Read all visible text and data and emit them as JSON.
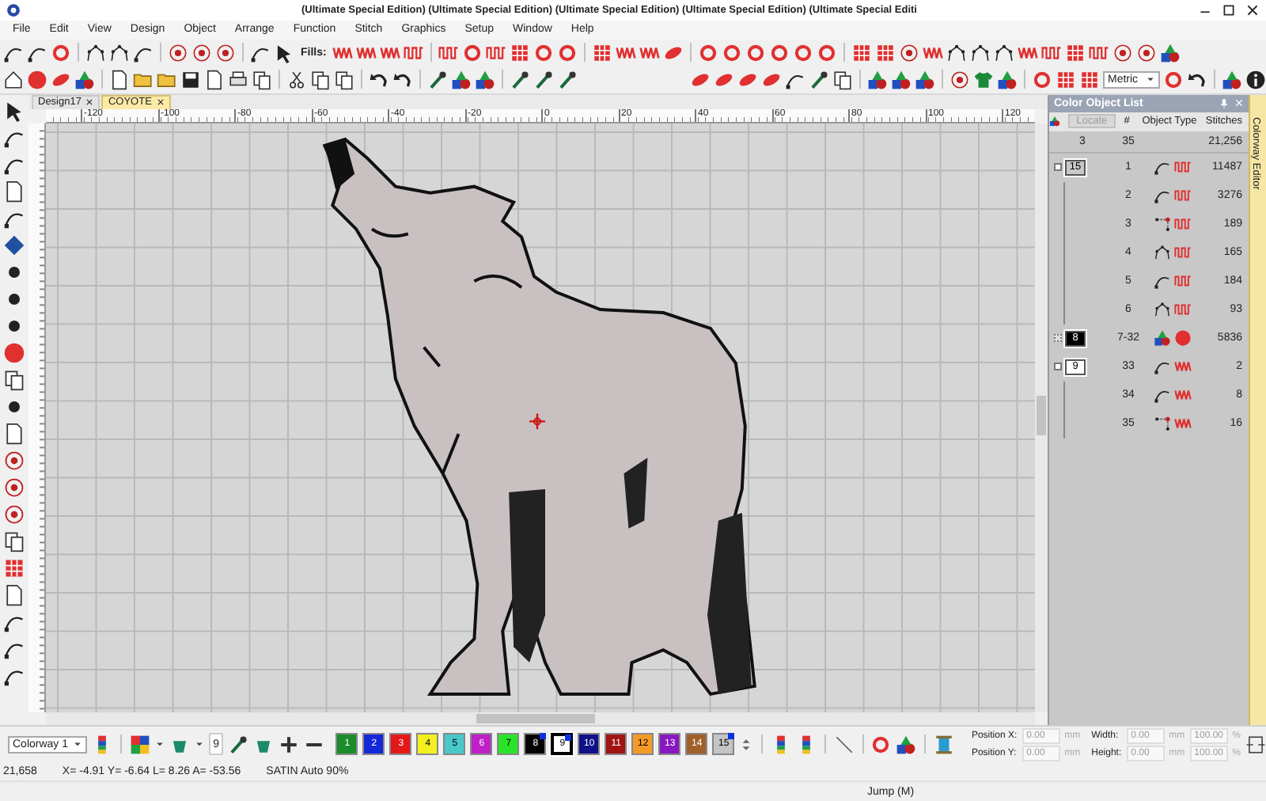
{
  "window": {
    "title": "(Ultimate Special Edition) (Ultimate Special Edition) (Ultimate Special Edition) (Ultimate Special Edition) (Ultimate Special Editi"
  },
  "menu": [
    "File",
    "Edit",
    "View",
    "Design",
    "Object",
    "Arrange",
    "Function",
    "Stitch",
    "Graphics",
    "Setup",
    "Window",
    "Help"
  ],
  "toolbar": {
    "fills_label": "Fills:",
    "units": "Metric"
  },
  "tabs": [
    {
      "label": "Design17",
      "selected": false
    },
    {
      "label": "COYOTE",
      "selected": true
    }
  ],
  "ruler": {
    "labels": [
      "-120",
      "-100",
      "-80",
      "-60",
      "-40",
      "-20",
      "0",
      "20",
      "40",
      "60",
      "80",
      "100",
      "120"
    ]
  },
  "color_object_list": {
    "title": "Color Object List",
    "columns": [
      "Locate",
      "#",
      "Object Type",
      "Stitches"
    ],
    "summary": {
      "colors": "3",
      "objects": "35",
      "stitches": "21,256"
    },
    "groups": [
      {
        "label": "15",
        "color": "#c8c8c8",
        "expanded": true,
        "rows": [
          {
            "number": "1",
            "object_type": [
              {
                "kind": "fill"
              },
              {
                "kind": "fillstitch"
              }
            ],
            "stitches": "11487"
          },
          {
            "number": "2",
            "object_type": [
              {
                "kind": "fill"
              },
              {
                "kind": "fillstitch"
              }
            ],
            "stitches": "3276"
          },
          {
            "number": "3",
            "object_type": [
              {
                "kind": "run"
              },
              {
                "kind": "fillstitch"
              }
            ],
            "stitches": "189"
          },
          {
            "number": "4",
            "object_type": [
              {
                "kind": "outline"
              },
              {
                "kind": "fillstitch"
              }
            ],
            "stitches": "165"
          },
          {
            "number": "5",
            "object_type": [
              {
                "kind": "fill"
              },
              {
                "kind": "fillstitch"
              }
            ],
            "stitches": "184"
          },
          {
            "number": "6",
            "object_type": [
              {
                "kind": "outline"
              },
              {
                "kind": "fillstitch"
              }
            ],
            "stitches": "93"
          }
        ]
      },
      {
        "label": "8",
        "color": "#000000",
        "expanded": false,
        "rows": [
          {
            "number": "7-32",
            "object_type": [
              {
                "kind": "image"
              },
              {
                "kind": "ball"
              }
            ],
            "stitches": "5836"
          }
        ]
      },
      {
        "label": "9",
        "color": "#ffffff",
        "expanded": true,
        "rows": [
          {
            "number": "33",
            "object_type": [
              {
                "kind": "fill"
              },
              {
                "kind": "satin"
              }
            ],
            "stitches": "2"
          },
          {
            "number": "34",
            "object_type": [
              {
                "kind": "fill"
              },
              {
                "kind": "satin"
              }
            ],
            "stitches": "8"
          },
          {
            "number": "35",
            "object_type": [
              {
                "kind": "run"
              },
              {
                "kind": "satin"
              }
            ],
            "stitches": "16"
          }
        ]
      }
    ]
  },
  "side_tab": "Colorway Editor",
  "bottom_toolbar": {
    "colorway": "Colorway 1",
    "current_color": "9",
    "swatches": [
      {
        "label": "1",
        "color": "#1a8c2a",
        "selected": false,
        "in_use": false
      },
      {
        "label": "2",
        "color": "#1428d8",
        "selected": false,
        "in_use": false
      },
      {
        "label": "3",
        "color": "#e41818",
        "selected": false,
        "in_use": false
      },
      {
        "label": "4",
        "color": "#f4f020",
        "selected": false,
        "in_use": false
      },
      {
        "label": "5",
        "color": "#48c8c8",
        "selected": false,
        "in_use": false
      },
      {
        "label": "6",
        "color": "#c020c8",
        "selected": false,
        "in_use": false
      },
      {
        "label": "7",
        "color": "#28e428",
        "selected": false,
        "in_use": false
      },
      {
        "label": "8",
        "color": "#000000",
        "selected": false,
        "in_use": true
      },
      {
        "label": "9",
        "color": "#ffffff",
        "selected": true,
        "in_use": true
      },
      {
        "label": "10",
        "color": "#101088",
        "selected": false,
        "in_use": false
      },
      {
        "label": "11",
        "color": "#a01414",
        "selected": false,
        "in_use": false
      },
      {
        "label": "12",
        "color": "#f49a28",
        "selected": false,
        "in_use": false
      },
      {
        "label": "13",
        "color": "#8818c0",
        "selected": false,
        "in_use": false
      },
      {
        "label": "14",
        "color": "#a0602a",
        "selected": false,
        "in_use": false
      },
      {
        "label": "15",
        "color": "#c4c4c4",
        "selected": false,
        "in_use": true
      }
    ],
    "position": [
      {
        "label": "Position X:",
        "value": "0.00",
        "unit": "mm"
      },
      {
        "label": "Position Y:",
        "value": "0.00",
        "unit": "mm"
      }
    ],
    "size": [
      {
        "label": "Width:",
        "value": "0.00",
        "unit": "mm",
        "percent": "100.00",
        "percent_unit": "%"
      },
      {
        "label": "Height:",
        "value": "0.00",
        "unit": "mm",
        "percent": "100.00",
        "percent_unit": "%"
      }
    ]
  },
  "status": {
    "stitch_count": "21,658",
    "coordinates": "X= -4.91 Y= -6.64 L= 8.26 A= -53.56",
    "stitch_type": "SATIN Auto 90%",
    "command": "Jump (M)"
  }
}
